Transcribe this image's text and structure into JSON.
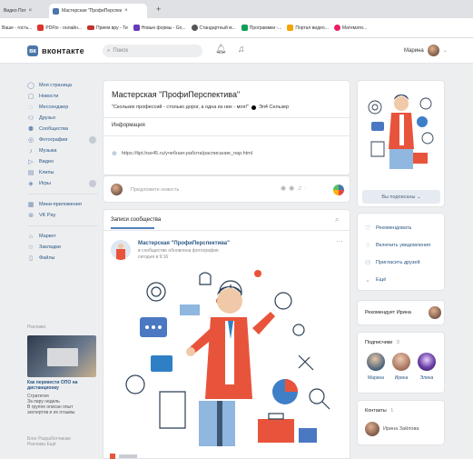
{
  "browser": {
    "tabs": [
      {
        "title": "Видео Пот"
      },
      {
        "title": "Мастерская \"ПрофиПерспек"
      }
    ],
    "new_tab": "+",
    "bookmarks": [
      {
        "label": "Ваше - гость..."
      },
      {
        "label": "PDFto - онлайн..."
      },
      {
        "label": "Прием вру - Ти"
      },
      {
        "label": "Новые формы - Go..."
      },
      {
        "label": "Стандартный м..."
      },
      {
        "label": "Программки -..."
      },
      {
        "label": "Портал видео..."
      },
      {
        "label": "Математи..."
      }
    ]
  },
  "header": {
    "logo": "вконтакте",
    "logo_mark": "вк",
    "search_placeholder": "Поиск",
    "user_name": "Марина"
  },
  "nav": {
    "items": [
      {
        "label": "Моя страница",
        "icon": "user-icon"
      },
      {
        "label": "Новости",
        "icon": "news-icon"
      },
      {
        "label": "Мессенджер",
        "icon": "chat-icon"
      },
      {
        "label": "Друзья",
        "icon": "friends-icon"
      },
      {
        "label": "Сообщества",
        "icon": "groups-icon"
      },
      {
        "label": "Фотографии",
        "icon": "photo-icon"
      },
      {
        "label": "Музыка",
        "icon": "music-icon"
      },
      {
        "label": "Видео",
        "icon": "video-icon"
      },
      {
        "label": "Клипы",
        "icon": "clips-icon"
      },
      {
        "label": "Игры",
        "icon": "games-icon"
      }
    ],
    "items2": [
      {
        "label": "Мини-приложения",
        "icon": "apps-icon"
      },
      {
        "label": "VK Pay",
        "icon": "pay-icon"
      }
    ],
    "items3": [
      {
        "label": "Маркет",
        "icon": "market-icon"
      },
      {
        "label": "Закладки",
        "icon": "bookmark-icon"
      },
      {
        "label": "Файлы",
        "icon": "files-icon"
      }
    ],
    "ad_label": "Реклама",
    "ad_title": "Как перевести ОПО на дистанционку",
    "ad_text": "Стратегия\nЗа пару недель\nВ группе описан опыт\nэкспертов и их отзывы",
    "footer": "Блог   Разработчикам\nРеклама   Ещё"
  },
  "group": {
    "title": "Мастерская \"ПрофиПерспектива\"",
    "status": "\"Скольких профессий - столько дорог, а одна из них - моя!\"",
    "status_tag": "Эл4 Сельзер",
    "info_label": "Информация",
    "link": "https://tipt.hse45.ru/учебная-работа/расписание_пар.html"
  },
  "composer": {
    "placeholder": "Предложите новость"
  },
  "feed": {
    "tab": "Записи сообщества",
    "author": "Мастерская \"ПрофиПерспектива\"",
    "action": "в сообществе обновлена фотография",
    "date": "сегодня в 9:16"
  },
  "right": {
    "subscribe_button": "Вы подписаны ⌄",
    "actions": [
      {
        "label": "Рекомендовать",
        "icon": "like-icon"
      },
      {
        "label": "Включить уведомления",
        "icon": "bell-icon"
      },
      {
        "label": "Пригласить друзей",
        "icon": "invite-icon"
      },
      {
        "label": "Ещё",
        "icon": "more-icon"
      }
    ],
    "recommends": "Рекомендует Ирина",
    "subscribers_title": "Подписчики",
    "subscribers_count": "3",
    "subscribers": [
      {
        "name": "Марина"
      },
      {
        "name": "Ирина"
      },
      {
        "name": "Элина"
      }
    ],
    "contacts_title": "Контакты",
    "contacts_count": "1",
    "contact_name": "Ирина Зайлова"
  },
  "colors": {
    "brand": "#4a76a8",
    "link": "#2a5885",
    "page_bg": "#edeef0"
  }
}
